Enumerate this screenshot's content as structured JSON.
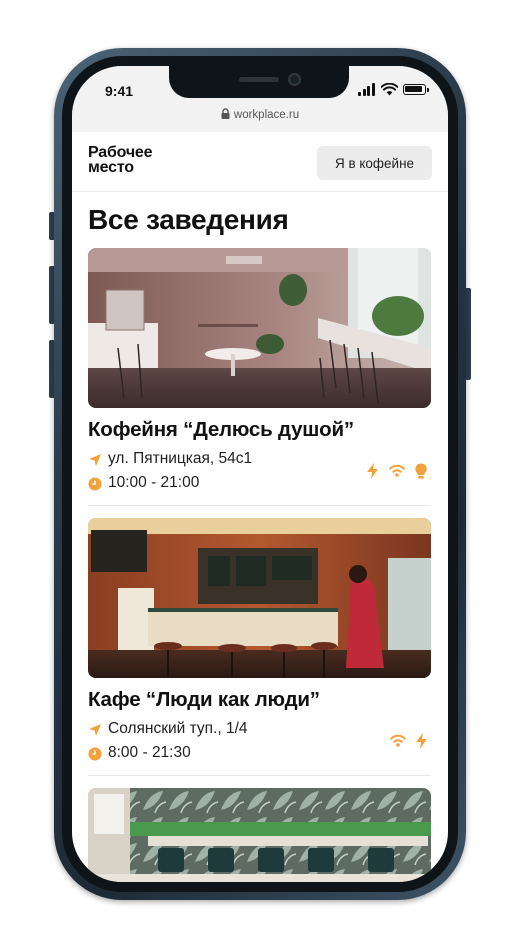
{
  "status_bar": {
    "time": "9:41"
  },
  "browser": {
    "url": "workplace.ru"
  },
  "header": {
    "logo_line1": "Рабочее",
    "logo_line2": "место",
    "checkin_label": "Я в кофейне"
  },
  "page": {
    "title": "Все заведения"
  },
  "venues": [
    {
      "name": "Кофейня “Делюсь душой”",
      "address": "ул. Пятницкая, 54с1",
      "hours": "10:00 - 21:00",
      "amenities": [
        "power-icon",
        "wifi-icon",
        "lightbulb-icon"
      ]
    },
    {
      "name": "Кафе “Люди как люди”",
      "address": "Солянский туп., 1/4",
      "hours": "8:00 - 21:30",
      "amenities": [
        "wifi-icon",
        "power-icon"
      ]
    }
  ],
  "colors": {
    "accent": "#f2a13c",
    "text": "#111111",
    "button_bg": "#ececec"
  }
}
